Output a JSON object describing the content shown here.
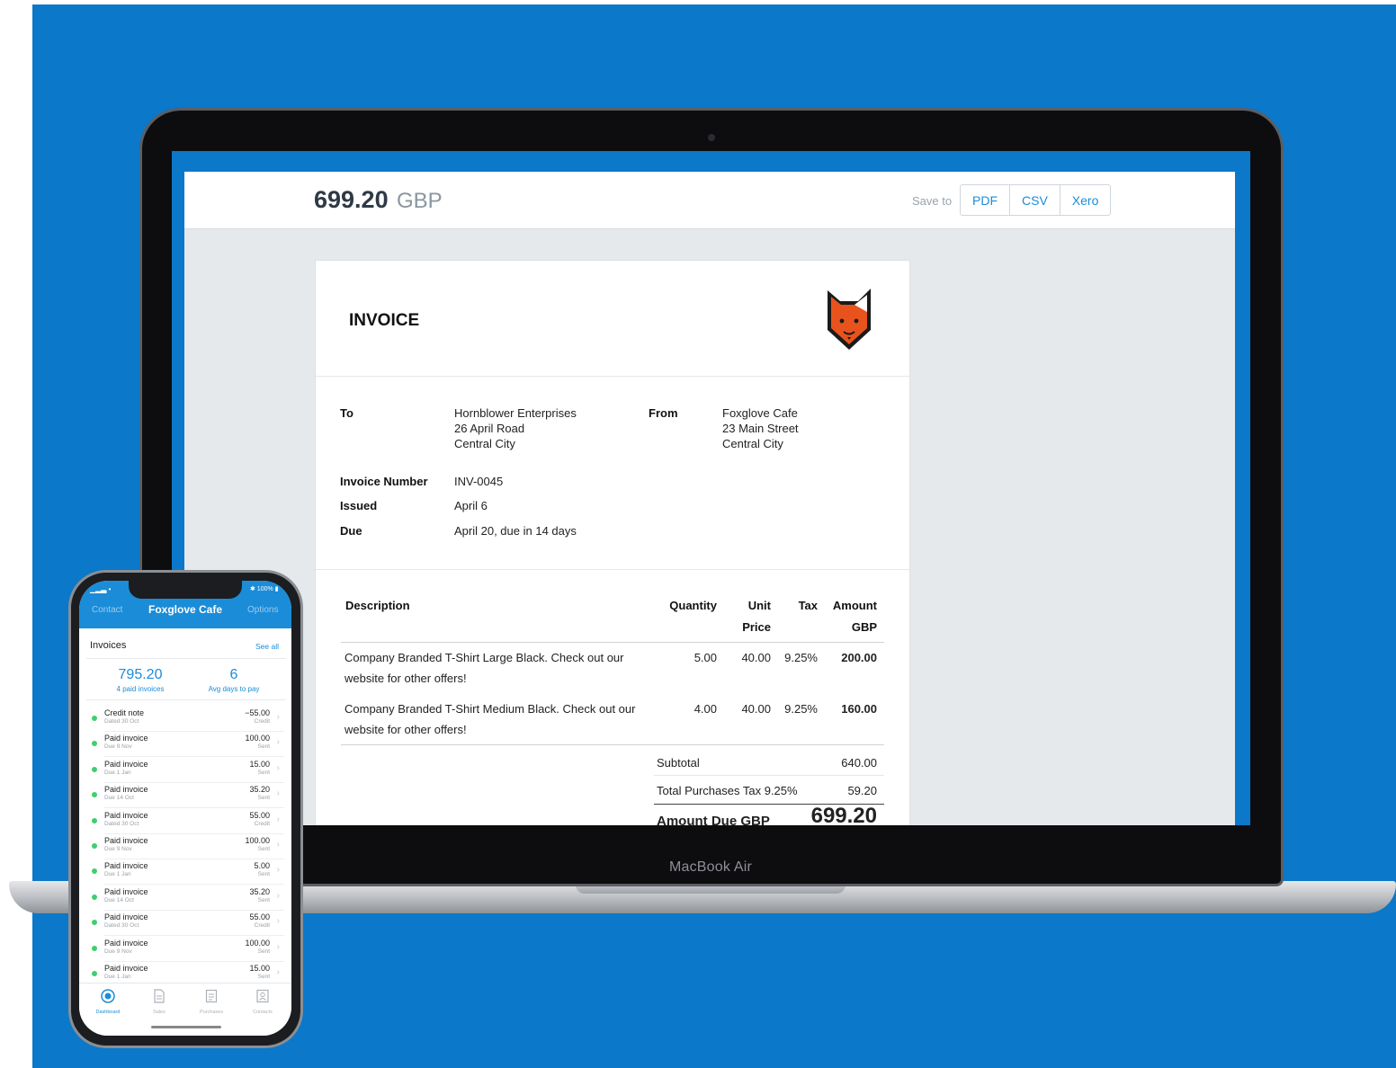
{
  "laptop": {
    "label": "MacBook Air"
  },
  "app": {
    "amount": "699.20",
    "currency": "GBP",
    "save_to_label": "Save to",
    "save_buttons": [
      "PDF",
      "CSV",
      "Xero"
    ]
  },
  "invoice": {
    "title": "INVOICE",
    "to_label": "To",
    "to_lines": [
      "Hornblower Enterprises",
      "26 April Road",
      "Central City"
    ],
    "from_label": "From",
    "from_lines": [
      "Foxglove Cafe",
      "23 Main Street",
      "Central City"
    ],
    "number_label": "Invoice Number",
    "number": "INV-0045",
    "issued_label": "Issued",
    "issued": "April 6",
    "due_label": "Due",
    "due": "April 20, due in 14 days",
    "columns": {
      "description": "Description",
      "quantity": "Quantity",
      "unit_price_1": "Unit",
      "unit_price_2": "Price",
      "tax": "Tax",
      "amount_1": "Amount",
      "amount_2": "GBP"
    },
    "lines": [
      {
        "desc1": "Company Branded T-Shirt Large Black. Check out our",
        "desc2": "website for other offers!",
        "qty": "5.00",
        "price": "40.00",
        "tax": "9.25%",
        "amount": "200.00"
      },
      {
        "desc1": "Company Branded T-Shirt Medium Black. Check out our",
        "desc2": "website for other offers!",
        "qty": "4.00",
        "price": "40.00",
        "tax": "9.25%",
        "amount": "160.00"
      }
    ],
    "subtotal_label": "Subtotal",
    "subtotal": "640.00",
    "tax_label": "Total Purchases Tax 9.25%",
    "tax_total": "59.20",
    "due_total_label": "Amount Due GBP",
    "due_total": "699.20",
    "logo_colors": {
      "fox": "#E8531D",
      "outline": "#1a1a1a"
    }
  },
  "phone": {
    "status_left": "▁▂▃ •",
    "status_right": "✱ 100% ▮",
    "header": {
      "left": "Contact",
      "title": "Foxglove Cafe",
      "right": "Options"
    },
    "section_title": "Invoices",
    "see_all": "See all",
    "stats": [
      {
        "value": "795.20",
        "label": "4 paid invoices"
      },
      {
        "value": "6",
        "label": "Avg days to pay"
      }
    ],
    "rows": [
      {
        "title": "Credit note",
        "sub": "Dated 30 Oct",
        "amount": "−55.00",
        "status": "Credit"
      },
      {
        "title": "Paid invoice",
        "sub": "Due 9 Nov",
        "amount": "100.00",
        "status": "Sent"
      },
      {
        "title": "Paid invoice",
        "sub": "Due 1 Jan",
        "amount": "15.00",
        "status": "Sent"
      },
      {
        "title": "Paid invoice",
        "sub": "Due 14 Oct",
        "amount": "35.20",
        "status": "Sent"
      },
      {
        "title": "Paid invoice",
        "sub": "Dated 30 Oct",
        "amount": "55.00",
        "status": "Credit"
      },
      {
        "title": "Paid invoice",
        "sub": "Due 9 Nov",
        "amount": "100.00",
        "status": "Sent"
      },
      {
        "title": "Paid invoice",
        "sub": "Due 1 Jan",
        "amount": "5.00",
        "status": "Sent"
      },
      {
        "title": "Paid invoice",
        "sub": "Due 14 Oct",
        "amount": "35.20",
        "status": "Sent"
      },
      {
        "title": "Paid invoice",
        "sub": "Dated 30 Oct",
        "amount": "55.00",
        "status": "Credit"
      },
      {
        "title": "Paid invoice",
        "sub": "Due 9 Nov",
        "amount": "100.00",
        "status": "Sent"
      },
      {
        "title": "Paid invoice",
        "sub": "Due 1 Jan",
        "amount": "15.00",
        "status": "Sent"
      }
    ],
    "tabs": [
      {
        "label": "Dashboard",
        "icon": "dashboard-icon"
      },
      {
        "label": "Sales",
        "icon": "sales-icon"
      },
      {
        "label": "Purchases",
        "icon": "purchases-icon"
      },
      {
        "label": "Contacts",
        "icon": "contacts-icon"
      }
    ]
  },
  "colors": {
    "background": "#0B78C9",
    "accent": "#1B8CD8",
    "paid_dot": "#3FCF6E"
  }
}
